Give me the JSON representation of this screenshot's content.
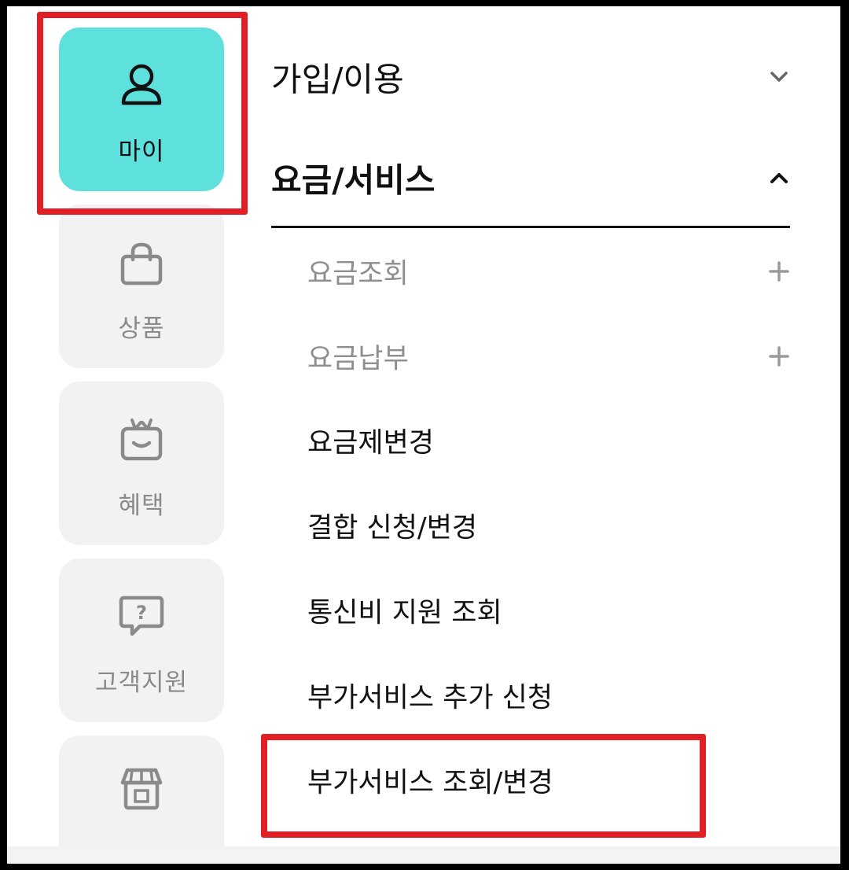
{
  "sidebar": {
    "items": [
      {
        "label": "마이",
        "icon": "person-icon",
        "active": true
      },
      {
        "label": "상품",
        "icon": "shopping-bag-icon"
      },
      {
        "label": "혜택",
        "icon": "gift-icon"
      },
      {
        "label": "고객지원",
        "icon": "question-chat-icon"
      },
      {
        "label": "",
        "icon": "store-icon"
      }
    ]
  },
  "menu": {
    "sections": [
      {
        "label": "가입/이용",
        "expanded": false,
        "toggle_icon": "chevron-down-icon"
      },
      {
        "label": "요금/서비스",
        "expanded": true,
        "toggle_icon": "chevron-up-icon"
      }
    ],
    "sub_items": [
      {
        "label": "요금조회",
        "expandable": true,
        "toggle_icon": "plus-icon"
      },
      {
        "label": "요금납부",
        "expandable": true,
        "toggle_icon": "plus-icon"
      },
      {
        "label": "요금제변경"
      },
      {
        "label": "결합 신청/변경"
      },
      {
        "label": "통신비 지원 조회"
      },
      {
        "label": "부가서비스 추가 신청"
      },
      {
        "label": "부가서비스 조회/변경",
        "highlighted": true
      }
    ]
  },
  "colors": {
    "active_tile": "#5ee0dd",
    "inactive_tile": "#f2f2f2",
    "highlight": "#e31f26",
    "muted_text": "#8e8e8e"
  }
}
